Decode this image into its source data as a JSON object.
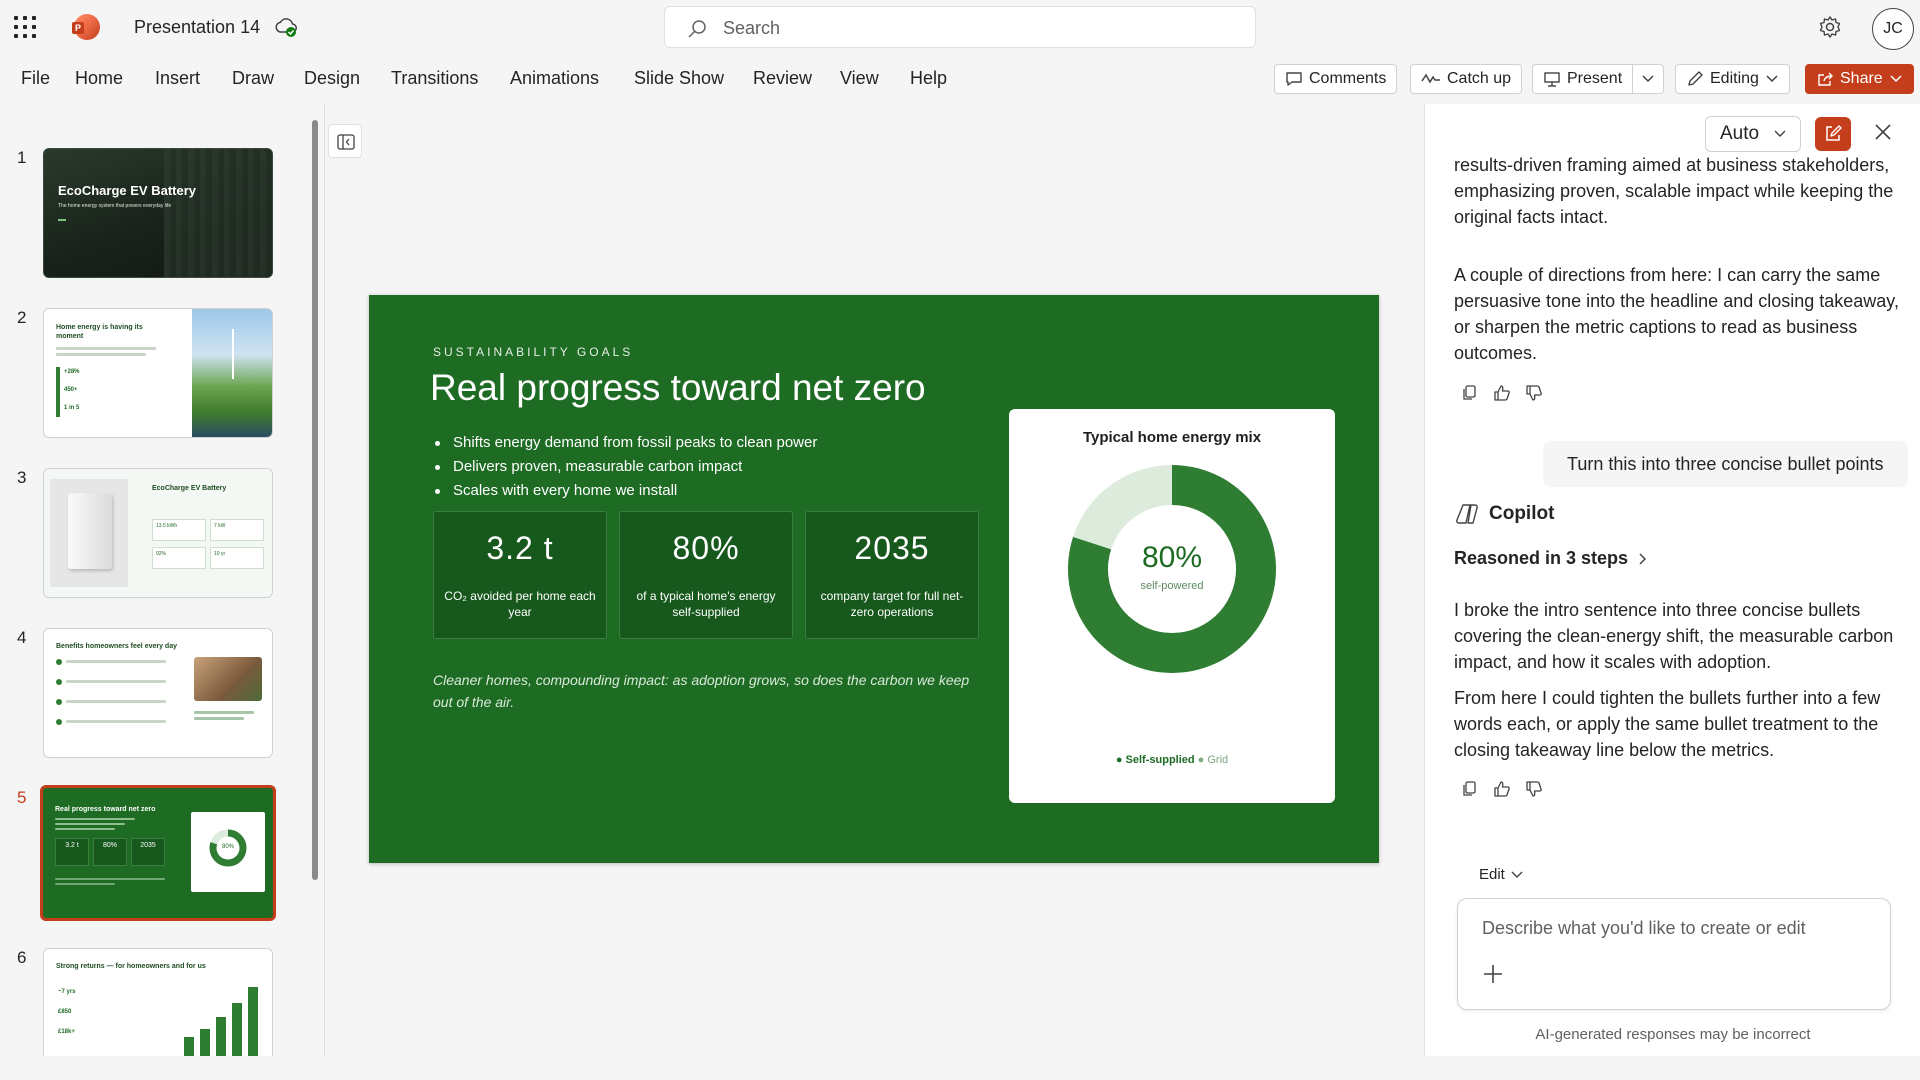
{
  "app": {
    "title": "Presentation 14",
    "search_placeholder": "Search",
    "user_initials": "JC",
    "accent": "#c43e1c"
  },
  "menu": [
    "File",
    "Home",
    "Insert",
    "Draw",
    "Design",
    "Transitions",
    "Animations",
    "Slide Show",
    "Review",
    "View",
    "Help"
  ],
  "toolbar": {
    "comments": "Comments",
    "catch_up": "Catch up",
    "present": "Present",
    "editing": "Editing",
    "share": "Share"
  },
  "thumbnails": {
    "numbers": [
      "1",
      "2",
      "3",
      "4",
      "5",
      "6"
    ],
    "selected": "5",
    "t1": {
      "title": "EcoCharge EV Battery",
      "subtitle": "The home energy system that powers everyday life"
    },
    "t2": {
      "title": "Home energy is having its moment",
      "stats": [
        "+28%",
        "450+",
        "1 in 5"
      ]
    },
    "t3": {
      "title": "EcoCharge EV Battery",
      "stats": [
        "13.5 kWh",
        "7 kW",
        "92%",
        "10 yr"
      ]
    },
    "t4": {
      "title": "Benefits homeowners feel every day"
    },
    "t5": {
      "title": "Real progress toward net zero",
      "metrics": [
        "3.2 t",
        "80%",
        "2035"
      ],
      "donut": "80%"
    },
    "t6": {
      "title": "Strong returns — for homeowners and for us",
      "stats": [
        "~7 yrs",
        "£850",
        "£18k+"
      ]
    }
  },
  "slide": {
    "eyebrow": "SUSTAINABILITY GOALS",
    "title": "Real progress toward net zero",
    "bullets": [
      "Shifts energy demand from fossil peaks to clean power",
      "Delivers proven, measurable carbon impact",
      "Scales with every home we install"
    ],
    "metrics": [
      {
        "value": "3.2 t",
        "label": "CO₂ avoided per home each year"
      },
      {
        "value": "80%",
        "label": "of a typical home's energy self-supplied"
      },
      {
        "value": "2035",
        "label": "company target for full net-zero operations"
      }
    ],
    "takeaway": "Cleaner homes, compounding impact: as adoption grows, so does the carbon we keep out of the air.",
    "colors": {
      "background": "#1e6b24",
      "self_supplied": "#2e7d32",
      "grid": "#dcebdc"
    }
  },
  "chart_data": {
    "type": "pie",
    "title": "Typical home energy mix",
    "center_value": "80%",
    "center_label": "self-powered",
    "categories": [
      "Self-supplied",
      "Grid"
    ],
    "values": [
      80,
      20
    ]
  },
  "copilot": {
    "mode": "Auto",
    "prev_message_partial": "I rewrote the selected intro line with a more confident, results-driven framing aimed at business stakeholders, emphasizing proven, scalable impact while keeping the original facts intact.",
    "prev_message_2": "A couple of directions from here: I can carry the same persuasive tone into the headline and closing takeaway, or sharpen the metric captions to read as business outcomes.",
    "user_message": "Turn this into three concise bullet points",
    "assistant_name": "Copilot",
    "reasoned": "Reasoned in 3 steps",
    "response_1": "I broke the intro sentence into three concise bullets covering the clean-energy shift, the measurable carbon impact, and how it scales with adoption.",
    "response_2": "From here I could tighten the bullets further into a few words each, or apply the same bullet treatment to the closing takeaway line below the metrics.",
    "edit_label": "Edit",
    "composer_placeholder": "Describe what you'd like to create or edit",
    "disclaimer": "AI-generated responses may be incorrect"
  }
}
